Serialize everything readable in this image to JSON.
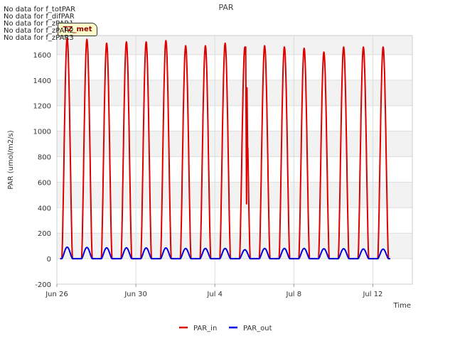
{
  "nodata_messages": [
    "No data for f_totPAR",
    "No data for f_difPAR",
    "No data for f_zPAR1",
    "No data for f_zPAR2",
    "No data for f_zPAR3"
  ],
  "badge_label": "TZ_met",
  "chart_data": {
    "type": "line",
    "title": "PAR",
    "xlabel": "Time",
    "ylabel": "PAR (umol/m2/s)",
    "ylim": [
      -200,
      1750
    ],
    "xlim": [
      "2022-06-26",
      "2022-07-14"
    ],
    "yticks": [
      -200,
      0,
      200,
      400,
      600,
      800,
      1000,
      1200,
      1400,
      1600
    ],
    "xticks": [
      {
        "date": "2022-06-26",
        "label": "Jun 26"
      },
      {
        "date": "2022-06-30",
        "label": "Jun 30"
      },
      {
        "date": "2022-07-04",
        "label": "Jul 4"
      },
      {
        "date": "2022-07-08",
        "label": "Jul 8"
      },
      {
        "date": "2022-07-12",
        "label": "Jul 12"
      }
    ],
    "grid": true,
    "legend_position": "bottom",
    "day_start_date": "2022-06-26",
    "series": [
      {
        "name": "PAR_in",
        "color": "#dd0000",
        "daily_peaks": [
          1730,
          1720,
          1690,
          1700,
          1700,
          1710,
          1670,
          1670,
          1690,
          1660,
          1670,
          1660,
          1650,
          1620,
          1660,
          1660,
          1660
        ],
        "cloudy_day_points": [
          {
            "date": "2022-07-05 13:30",
            "value": 1660
          },
          {
            "date": "2022-07-05 14:30",
            "value": 430
          },
          {
            "date": "2022-07-05 15:00",
            "value": 1340
          },
          {
            "date": "2022-07-05 16:00",
            "value": 750
          }
        ]
      },
      {
        "name": "PAR_out",
        "color": "#0000dd",
        "daily_peaks": [
          90,
          88,
          85,
          85,
          84,
          84,
          80,
          80,
          80,
          70,
          80,
          80,
          80,
          78,
          78,
          76,
          75
        ]
      }
    ]
  }
}
